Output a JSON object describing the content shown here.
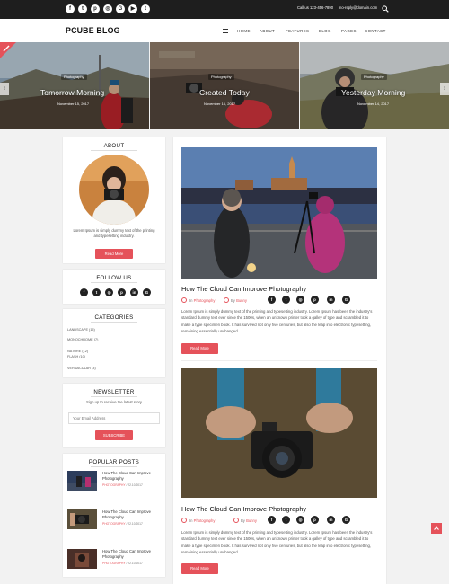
{
  "topbar": {
    "social_icons": [
      {
        "icon": "facebook-icon",
        "glyph": "f"
      },
      {
        "icon": "twitter-icon",
        "glyph": "t"
      },
      {
        "icon": "pinterest-icon",
        "glyph": "p"
      },
      {
        "icon": "instagram-icon",
        "glyph": "◎"
      },
      {
        "icon": "google-plus-icon",
        "glyph": "G"
      },
      {
        "icon": "youtube-icon",
        "glyph": "▶"
      },
      {
        "icon": "tumblr-icon",
        "glyph": "t"
      }
    ],
    "phone": "Call us 123-456-7890",
    "email": "no-reply@domain.com"
  },
  "header": {
    "logo": "PCUBE BLOG",
    "nav": [
      "HOME",
      "ABOUT",
      "FEATURES",
      "BLOG",
      "PAGES",
      "CONTACT"
    ]
  },
  "slider": {
    "slides": [
      {
        "category": "Photography",
        "title": "Tomorrow Morning",
        "date": "November 15, 2017"
      },
      {
        "category": "Photography",
        "title": "Created Today",
        "date": "November 16, 2017"
      },
      {
        "category": "Photography",
        "title": "Yesterday Morning",
        "date": "November 14, 2017"
      }
    ]
  },
  "about": {
    "title": "ABOUT",
    "text": "Lorem Ipsum is simply dummy text of the printing and typesetting industry.",
    "button": "Read More"
  },
  "follow": {
    "title": "FOLLOW US",
    "icons": [
      {
        "icon": "facebook-icon",
        "glyph": "f"
      },
      {
        "icon": "twitter-icon",
        "glyph": "t"
      },
      {
        "icon": "instagram-icon",
        "glyph": "◎"
      },
      {
        "icon": "pinterest-icon",
        "glyph": "p"
      },
      {
        "icon": "linkedin-icon",
        "glyph": "in"
      },
      {
        "icon": "google-plus-icon",
        "glyph": "G"
      }
    ]
  },
  "categories": {
    "title": "CATEGORIES",
    "items": [
      "LANDSCAPE (15)",
      "MONOCHROME (7)",
      "NATURE (12)",
      "FLASH (10)",
      "VERNACULAR (3)"
    ]
  },
  "newsletter": {
    "title": "NEWSLETTER",
    "text": "Sign up to receive the latest story",
    "placeholder": "Your Email Address",
    "button": "SUBSCRIBE"
  },
  "popular": {
    "title": "POPULAR POSTS",
    "posts": [
      {
        "title": "How The Cloud Can Improve Photography",
        "category": "PHOTOGRAPHY",
        "date": "22.10.2017"
      },
      {
        "title": "How The Cloud Can Improve Photography",
        "category": "PHOTOGRAPHY",
        "date": "22.10.2017"
      },
      {
        "title": "How The Cloud Can Improve Photography",
        "category": "PHOTOGRAPHY",
        "date": "22.10.2017"
      }
    ]
  },
  "posts": [
    {
      "title": "How The Cloud Can Improve Photography",
      "category_prefix": "In",
      "category": "Photography",
      "author_prefix": "By",
      "author": "Bunny",
      "body": "Lorem Ipsum is simply dummy text of the printing and typesetting industry. Lorem Ipsum has been the industry's standard dummy text ever since the 1500s, when an unknown printer took a galley of type and scrambled it to make a type specimen book. It has survived not only five centuries, but also the leap into electronic typesetting, remaining essentially unchanged.",
      "button": "Read More"
    },
    {
      "title": "How The Cloud Can Improve Photography",
      "category_prefix": "In",
      "category": "Photography",
      "author_prefix": "By",
      "author": "Bunny",
      "body": "Lorem Ipsum is simply dummy text of the printing and typesetting industry. Lorem Ipsum has been the industry's standard dummy text ever since the 1500s, when an unknown printer took a galley of type and scrambled it to make a type specimen book. It has survived not only five centuries, but also the leap into electronic typesetting, remaining essentially unchanged.",
      "button": "Read More"
    }
  ],
  "post_share_icons": [
    {
      "icon": "facebook-icon",
      "glyph": "f"
    },
    {
      "icon": "twitter-icon",
      "glyph": "t"
    },
    {
      "icon": "instagram-icon",
      "glyph": "◎"
    },
    {
      "icon": "pinterest-icon",
      "glyph": "p"
    },
    {
      "icon": "linkedin-icon",
      "glyph": "in"
    },
    {
      "icon": "google-plus-icon",
      "glyph": "G"
    }
  ],
  "colors": {
    "accent": "#e5525a",
    "topbar": "#1e1e1e"
  }
}
